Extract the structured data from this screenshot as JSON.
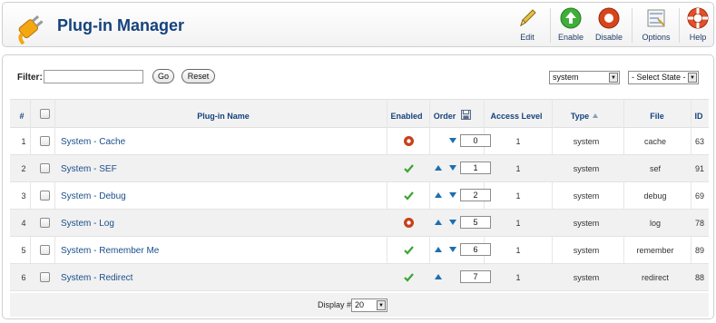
{
  "toolbar": {
    "title": "Plug-in Manager",
    "buttons": [
      {
        "label": "Edit",
        "icon": "pencil-icon"
      },
      {
        "label": "Enable",
        "icon": "enable-icon"
      },
      {
        "label": "Disable",
        "icon": "disable-icon"
      },
      {
        "label": "Options",
        "icon": "options-icon"
      },
      {
        "label": "Help",
        "icon": "help-icon"
      }
    ]
  },
  "filter": {
    "label": "Filter:",
    "value": "",
    "go_label": "Go",
    "reset_label": "Reset",
    "type_select": "system",
    "state_select": "- Select State -"
  },
  "table": {
    "headers": {
      "num": "#",
      "name": "Plug-in Name",
      "enabled": "Enabled",
      "order": "Order",
      "access": "Access Level",
      "type": "Type",
      "file": "File",
      "id": "ID"
    },
    "rows": [
      {
        "num": "1",
        "name": "System - Cache",
        "enabled": false,
        "order": "0",
        "up": false,
        "down": true,
        "access": "1",
        "type": "system",
        "file": "cache",
        "id": "63"
      },
      {
        "num": "2",
        "name": "System - SEF",
        "enabled": true,
        "order": "1",
        "up": true,
        "down": true,
        "access": "1",
        "type": "system",
        "file": "sef",
        "id": "91"
      },
      {
        "num": "3",
        "name": "System - Debug",
        "enabled": true,
        "order": "2",
        "up": true,
        "down": true,
        "access": "1",
        "type": "system",
        "file": "debug",
        "id": "69"
      },
      {
        "num": "4",
        "name": "System - Log",
        "enabled": false,
        "order": "5",
        "up": true,
        "down": true,
        "access": "1",
        "type": "system",
        "file": "log",
        "id": "78"
      },
      {
        "num": "5",
        "name": "System - Remember Me",
        "enabled": true,
        "order": "6",
        "up": true,
        "down": true,
        "access": "1",
        "type": "system",
        "file": "remember",
        "id": "89"
      },
      {
        "num": "6",
        "name": "System - Redirect",
        "enabled": true,
        "order": "7",
        "up": true,
        "down": false,
        "access": "1",
        "type": "system",
        "file": "redirect",
        "id": "88"
      }
    ]
  },
  "footer": {
    "display_label": "Display #",
    "display_value": "20"
  },
  "colors": {
    "title": "#14427c",
    "link": "#1a4f8a",
    "enabled_check": "#3aa532",
    "disabled_dot": "#c8401a",
    "arrow": "#1b6fb0"
  }
}
